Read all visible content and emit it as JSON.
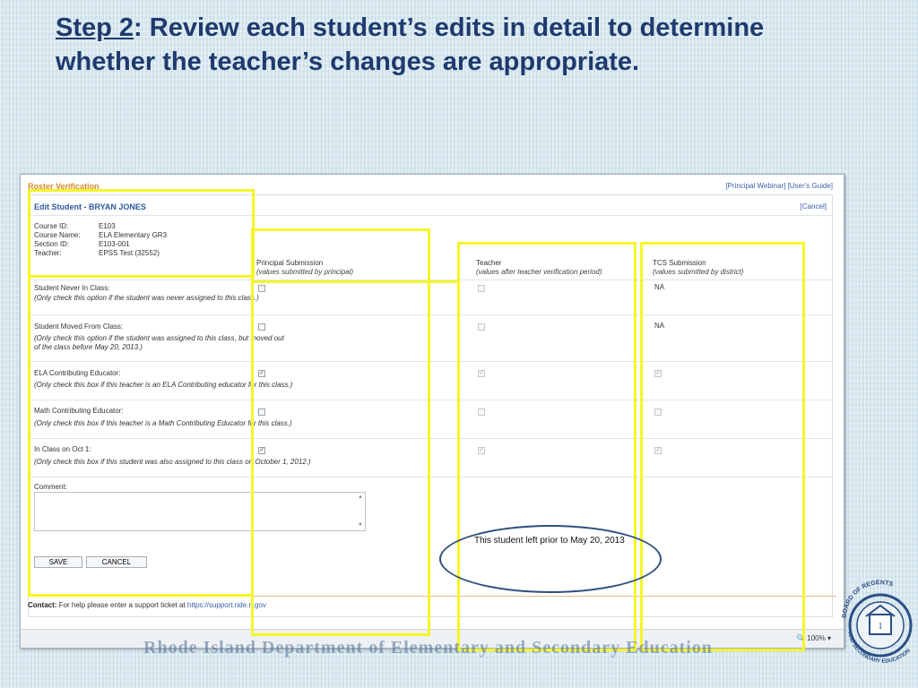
{
  "slide": {
    "title_step": "Step 2",
    "title_rest": ": Review each student’s edits in detail to determine whether the teacher’s changes are appropriate."
  },
  "app": {
    "title": "Roster Verification",
    "links": "[Principal Webinar] [User's Guide]",
    "edit_title": "Edit Student - BRYAN JONES",
    "cancel_link": "[Cancel]"
  },
  "course_info": [
    {
      "label": "Course ID:",
      "value": "E103"
    },
    {
      "label": "Course Name:",
      "value": "ELA Elementary GR3"
    },
    {
      "label": "Section ID:",
      "value": "E103-001"
    },
    {
      "label": "Teacher:",
      "value": "EPSS Test (32552)"
    }
  ],
  "columns": {
    "principal": {
      "title": "Principal Submission",
      "sub": "(values submitted by principal)"
    },
    "teacher": {
      "title": "Teacher",
      "sub": "(values after teacher verification period)"
    },
    "tcs": {
      "title": "TCS Submission",
      "sub": "(values submitted by district)"
    }
  },
  "rows": [
    {
      "label": "Student Never In Class:",
      "note": "(Only check this option if the student was never assigned to this class.)",
      "principal_checked": false,
      "teacher_checked": false,
      "tcs_value": "NA"
    },
    {
      "label": "Student Moved From Class:",
      "note": "(Only check this option if the student was assigned to this class, but moved out",
      "note2": "of the class before May 20, 2013.)",
      "principal_checked": false,
      "teacher_checked": false,
      "tcs_value": "NA"
    },
    {
      "label": "ELA Contributing Educator:",
      "note": "(Only check this box if this teacher is an ELA Contributing educator for this class.)",
      "principal_checked": true,
      "teacher_checked": true,
      "tcs_checked": true
    },
    {
      "label": "Math Contributing Educator:",
      "note": "(Only check this box if this teacher is a Math Contributing Educator for this class.)",
      "principal_checked": false,
      "teacher_checked": false,
      "tcs_checked": false
    },
    {
      "label": "In Class on Oct 1:",
      "note": "(Only check this box if this student was also assigned to this class on October 1, 2012.)",
      "principal_checked": true,
      "teacher_checked": true,
      "tcs_checked": true
    }
  ],
  "comment": {
    "label": "Comment:",
    "value": ""
  },
  "buttons": {
    "save": "SAVE",
    "cancel": "CANCEL"
  },
  "contact": {
    "label": "Contact:",
    "text": "For help please enter a support ticket at",
    "link": "https://support.ride.rl.gov"
  },
  "status": {
    "zoom": "100%"
  },
  "callout": {
    "text": "This student left prior to May 20, 2013"
  },
  "watermark": "Rhode Island Department of Elementary and Secondary Education",
  "seal": {
    "top": "BOARD OF REGENTS",
    "bottom": "AND SECONDARY EDUCATION",
    "center": "1"
  }
}
